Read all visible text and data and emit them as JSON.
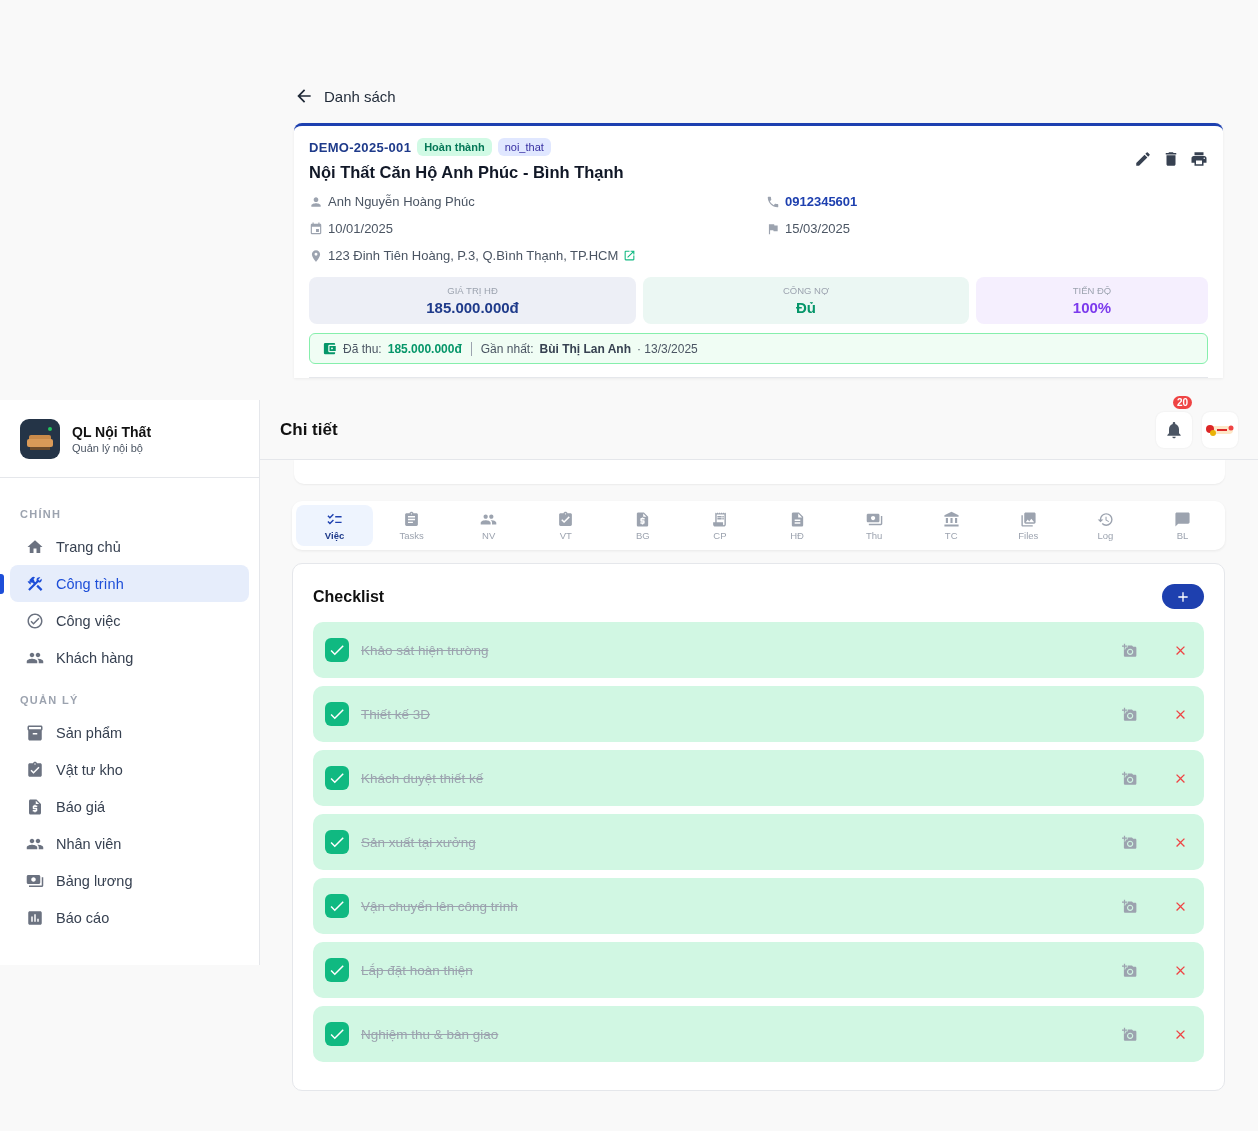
{
  "back": {
    "label": "Danh sách"
  },
  "project": {
    "code": "DEMO-2025-001",
    "badges": [
      {
        "label": "Hoàn thành",
        "kind": "status"
      },
      {
        "label": "noi_that",
        "kind": "category"
      }
    ],
    "title": "Nội Thất Căn Hộ Anh Phúc - Bình Thạnh",
    "info": [
      {
        "kind": "person",
        "text": "Anh Nguyễn Hoàng Phúc"
      },
      {
        "kind": "phone",
        "text": "0912345601"
      },
      {
        "kind": "start",
        "text": "10/01/2025"
      },
      {
        "kind": "deadline",
        "text": "15/03/2025"
      },
      {
        "kind": "address",
        "text": "123 Đinh Tiên Hoàng, P.3, Q.Bình Thạnh, TP.HCM"
      }
    ],
    "stats": [
      {
        "label": "GIÁ TRỊ HĐ",
        "value": "185.000.000đ",
        "color": "#1e3a8a"
      },
      {
        "label": "CÔNG NỢ",
        "value": "Đủ",
        "color": "#059669"
      },
      {
        "label": "TIẾN ĐỘ",
        "value": "100%",
        "color": "#7c3aed"
      }
    ],
    "payment": {
      "label": "Đã thu:",
      "amount": "185.000.000đ",
      "latest_label": "Gần nhất:",
      "latest_name": "Bùi Thị Lan Anh",
      "latest_date": "· 13/3/2025"
    }
  },
  "sidebar": {
    "brand": {
      "name": "QL Nội Thất",
      "subtitle": "Quản lý nội bộ"
    },
    "sections": [
      {
        "title": "CHÍNH",
        "items": [
          {
            "label": "Trang chủ",
            "selected": false
          },
          {
            "label": "Công trình",
            "selected": true
          },
          {
            "label": "Công việc",
            "selected": false
          },
          {
            "label": "Khách hàng",
            "selected": false
          }
        ]
      },
      {
        "title": "QUẢN LÝ",
        "items": [
          {
            "label": "Sản phẩm",
            "selected": false
          },
          {
            "label": "Vật tư kho",
            "selected": false
          },
          {
            "label": "Báo giá",
            "selected": false
          },
          {
            "label": "Nhân viên",
            "selected": false
          },
          {
            "label": "Bảng lương",
            "selected": false
          },
          {
            "label": "Báo cáo",
            "selected": false
          }
        ]
      }
    ]
  },
  "header": {
    "title": "Chi tiết",
    "notifications": "20"
  },
  "tabs": [
    {
      "label": "Việc",
      "selected": true
    },
    {
      "label": "Tasks",
      "selected": false
    },
    {
      "label": "NV",
      "selected": false
    },
    {
      "label": "VT",
      "selected": false
    },
    {
      "label": "BG",
      "selected": false
    },
    {
      "label": "CP",
      "selected": false
    },
    {
      "label": "HĐ",
      "selected": false
    },
    {
      "label": "Thu",
      "selected": false
    },
    {
      "label": "TC",
      "selected": false
    },
    {
      "label": "Files",
      "selected": false
    },
    {
      "label": "Log",
      "selected": false
    },
    {
      "label": "BL",
      "selected": false
    }
  ],
  "checklist": {
    "title": "Checklist",
    "items": [
      {
        "label": "Khảo sát hiện trường",
        "checked": true
      },
      {
        "label": "Thiết kế 3D",
        "checked": true
      },
      {
        "label": "Khách duyệt thiết kế",
        "checked": true
      },
      {
        "label": "Sản xuất tại xưởng",
        "checked": true
      },
      {
        "label": "Vận chuyển lên công trình",
        "checked": true
      },
      {
        "label": "Lắp đặt hoàn thiện",
        "checked": true
      },
      {
        "label": "Nghiệm thu & bàn giao",
        "checked": true
      }
    ]
  }
}
